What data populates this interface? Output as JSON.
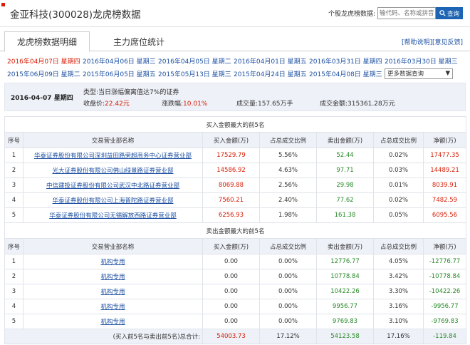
{
  "header": {
    "title": "金亚科技(300028)龙虎榜数据",
    "search_label": "个股龙虎榜数据:",
    "search_placeholder": "输代码、名称或拼音",
    "search_button": "查询"
  },
  "tabs": [
    {
      "label": "龙虎榜数据明细",
      "active": true
    },
    {
      "label": "主力席位统计",
      "active": false
    }
  ],
  "links": {
    "help": "[帮助说明]",
    "feedback": "[意见反馈]"
  },
  "dates_row1": [
    "2016年04月07日 星期四",
    "2016年04月06日 星期三",
    "2016年04月05日 星期二",
    "2016年04月01日 星期五",
    "2016年03月31日 星期四",
    "2016年03月30日 星期三"
  ],
  "dates_row2": [
    "2015年06月09日 星期二",
    "2015年06月05日 星期五",
    "2015年05月13日 星期三",
    "2015年04月24日 星期五",
    "2015年04月08日 星期三"
  ],
  "more_dates": "更多数据查询",
  "info": {
    "date": "2016-04-07 星期四",
    "type_label": "类型:",
    "type_value": "当日涨幅偏离值达7%的证券",
    "close_label": "收盘价:",
    "close_value": "22.42元",
    "change_label": "涨跌幅:",
    "change_value": "10.01%",
    "volume_label": "成交量:",
    "volume_value": "157.65万手",
    "amount_label": "成交金额:",
    "amount_value": "315361.28万元"
  },
  "buy_table": {
    "title": "买入金额最大的前5名",
    "headers": [
      "序号",
      "交易营业部名称",
      "买入金额(万)",
      "占总成交比例",
      "卖出金额(万)",
      "占总成交比例",
      "净额(万)"
    ],
    "rows": [
      [
        "1",
        "华泰证券股份有限公司深圳益田路荣超商务中心证券营业部",
        "17529.79",
        "5.56%",
        "52.44",
        "0.02%",
        "17477.35"
      ],
      [
        "2",
        "光大证券股份有限公司佛山绿景路证券营业部",
        "14586.92",
        "4.63%",
        "97.71",
        "0.03%",
        "14489.21"
      ],
      [
        "3",
        "中信建投证券股份有限公司武汉中北路证券营业部",
        "8069.88",
        "2.56%",
        "29.98",
        "0.01%",
        "8039.91"
      ],
      [
        "4",
        "华泰证券股份有限公司上海普陀路证券营业部",
        "7560.21",
        "2.40%",
        "77.62",
        "0.02%",
        "7482.59"
      ],
      [
        "5",
        "华泰证券股份有限公司无锡解放西路证券营业部",
        "6256.93",
        "1.98%",
        "161.38",
        "0.05%",
        "6095.56"
      ]
    ]
  },
  "sell_table": {
    "title": "卖出金额最大的前5名",
    "headers": [
      "序号",
      "交易营业部名称",
      "买入金额(万)",
      "占总成交比例",
      "卖出金额(万)",
      "占总成交比例",
      "净额(万)"
    ],
    "rows": [
      [
        "1",
        "机构专用",
        "0.00",
        "0.00%",
        "12776.77",
        "4.05%",
        "-12776.77"
      ],
      [
        "2",
        "机构专用",
        "0.00",
        "0.00%",
        "10778.84",
        "3.42%",
        "-10778.84"
      ],
      [
        "3",
        "机构专用",
        "0.00",
        "0.00%",
        "10422.26",
        "3.30%",
        "-10422.26"
      ],
      [
        "4",
        "机构专用",
        "0.00",
        "0.00%",
        "9956.77",
        "3.16%",
        "-9956.77"
      ],
      [
        "5",
        "机构专用",
        "0.00",
        "0.00%",
        "9769.83",
        "3.10%",
        "-9769.83"
      ]
    ]
  },
  "total": {
    "label": "(买入前5名与卖出前5名)总合计:",
    "buy": "54003.73",
    "buy_pct": "17.12%",
    "sell": "54123.58",
    "sell_pct": "17.16%",
    "net": "-119.84"
  },
  "colors": {
    "accent": "#1e50a2",
    "red": "#d81e06",
    "green": "#2a8a2a",
    "panel": "#eef1f8"
  }
}
